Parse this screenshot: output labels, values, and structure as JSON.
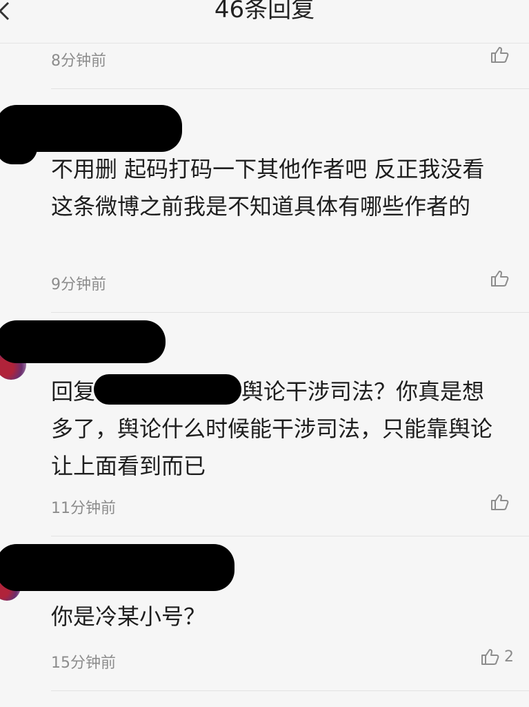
{
  "header": {
    "title": "46条回复"
  },
  "comments": [
    {
      "time": "8分钟前",
      "likes": ""
    },
    {
      "text": "不用删 起码打码一下其他作者吧 反正我没看这条微博之前我是不知道具体有哪些作者的",
      "time": "9分钟前",
      "likes": ""
    },
    {
      "reply_prefix": "回复",
      "text": "舆论干涉司法？你真是想多了，舆论什么时候能干涉司法，只能靠舆论让上面看到而已",
      "time": "11分钟前",
      "likes": ""
    },
    {
      "text": "你是冷某小号？",
      "time": "15分钟前",
      "likes": "2"
    }
  ],
  "icons": {
    "back": "chevron-left-icon",
    "like": "thumbs-up-icon"
  }
}
